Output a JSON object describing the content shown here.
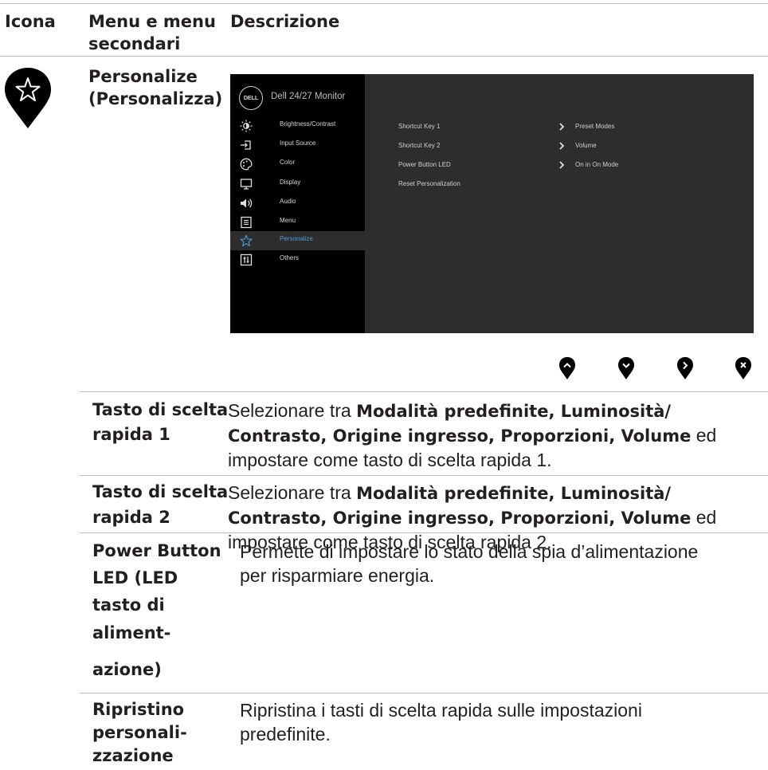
{
  "header": {
    "col_icon": "Icona",
    "col_menu_line1": "Menu e menu",
    "col_menu_line2": "secondari",
    "col_desc": "Descrizione"
  },
  "main": {
    "icon": "star-icon",
    "menu_line1": "Personalize",
    "menu_line2": "(Personalizza)"
  },
  "osd": {
    "logo": "DELL",
    "title": "Dell 24/27 Monitor",
    "menu": [
      {
        "label": "Brightness/Contrast",
        "icon": "brightness-icon"
      },
      {
        "label": "Input Source",
        "icon": "input-source-icon"
      },
      {
        "label": "Color",
        "icon": "color-icon"
      },
      {
        "label": "Display",
        "icon": "display-icon"
      },
      {
        "label": "Audio",
        "icon": "audio-icon"
      },
      {
        "label": "Menu",
        "icon": "menu-icon"
      },
      {
        "label": "Personalize",
        "icon": "star-icon",
        "selected": true
      },
      {
        "label": "Others",
        "icon": "others-icon"
      }
    ],
    "rows": [
      {
        "label": "Shortcut Key 1",
        "value": "Preset Modes"
      },
      {
        "label": "Shortcut Key 2",
        "value": "Volume"
      },
      {
        "label": "Power Button LED",
        "value": "On in On Mode"
      },
      {
        "label": "Reset Personalization",
        "value": ""
      }
    ],
    "accent": "#4e9bd6"
  },
  "nav_buttons": [
    "up-icon",
    "down-icon",
    "right-icon",
    "close-icon"
  ],
  "rows": [
    {
      "label_l1": "Tasto di scelta",
      "label_l2": "rapida 1",
      "d1_pre": "Selezionare tra ",
      "d1_bold": "Modalità predefinite, Luminosità/",
      "d2_bold": "Contrasto, Origine ingresso, Proporzioni, Volume",
      "d2_post": " ed",
      "d3": "impostare come tasto di scelta rapida 1."
    },
    {
      "label_l1": "Tasto di scelta",
      "label_l2": "rapida 2",
      "d1_pre": "Selezionare tra ",
      "d1_bold": "Modalità predefinite, Luminosità/",
      "d2_bold": "Contrasto, Origine ingresso, Proporzioni, Volume",
      "d2_post": " ed",
      "d3": "impostare come tasto di scelta rapida 2."
    },
    {
      "label_l1": "Power Button",
      "label_l2": "LED (LED",
      "label_l3": "tasto di",
      "label_l4": "aliment-",
      "label_l5": "azione)",
      "d1": "Permette di impostare lo stato della spia d’alimentazione",
      "d2": "per risparmiare energia."
    },
    {
      "label_l1": "Ripristino",
      "label_l2": "personali-",
      "label_l3": "zzazione",
      "d1": "Ripristina i tasti di scelta rapida sulle impostazioni",
      "d2": "predefinite."
    }
  ]
}
